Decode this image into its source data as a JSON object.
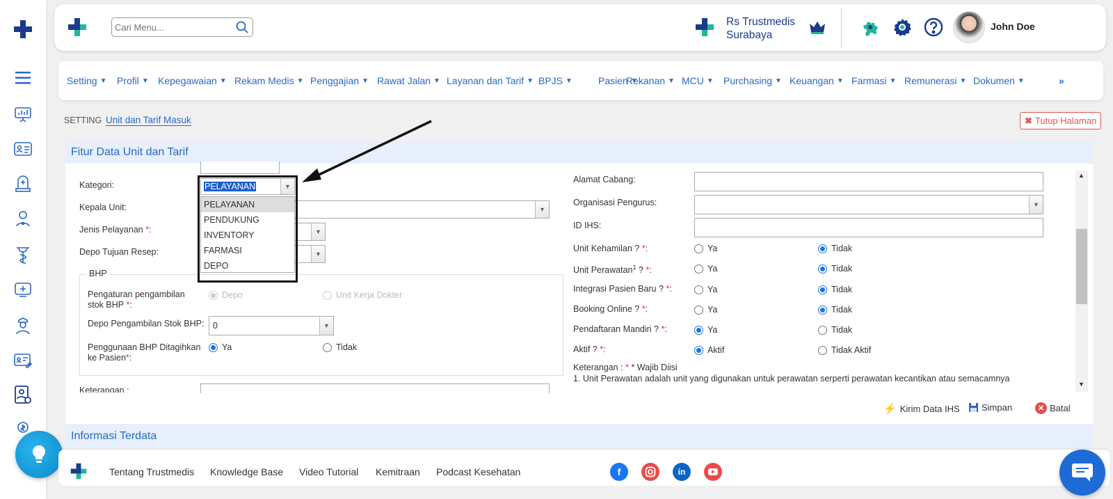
{
  "header": {
    "search_placeholder": "Cari Menu...",
    "hospital_line1": "Rs Trustmedis",
    "hospital_line2": "Surabaya",
    "user_name": "John Doe"
  },
  "menu": [
    {
      "label": "Setting"
    },
    {
      "label": "Profil"
    },
    {
      "label": "Kepegawaian"
    },
    {
      "label": "Rekam Medis"
    },
    {
      "label": "Penggajian"
    },
    {
      "label": "Rawat Jalan"
    },
    {
      "label": "Layanan dan Tarif"
    },
    {
      "label": "BPJS"
    },
    {
      "label": "Pasien"
    },
    {
      "label": "Rekanan"
    },
    {
      "label": "MCU"
    },
    {
      "label": "Purchasing"
    },
    {
      "label": "Keuangan"
    },
    {
      "label": "Farmasi"
    },
    {
      "label": "Remunerasi"
    },
    {
      "label": "Dokumen"
    }
  ],
  "menu_more": "»",
  "breadcrumb": {
    "root": "SETTING",
    "current": "Unit dan Tarif Masuk"
  },
  "close_page": "Tutup Halaman",
  "section1_title": "Fitur Data Unit dan Tarif",
  "section2_title": "Informasi Terdata",
  "form_left": {
    "kategori_label": "Kategori:",
    "kategori_value": "PELAYANAN",
    "kategori_options": [
      "PELAYANAN",
      "PENDUKUNG",
      "INVENTORY",
      "FARMASI",
      "DEPO"
    ],
    "kepala_unit_label": "Kepala Unit:",
    "jenis_pelayanan_label": "Jenis Pelayanan",
    "depo_tujuan_label": "Depo Tujuan Resep:",
    "bhp_legend": "BHP",
    "pengaturan_label_1": "Pengaturan pengambilan",
    "pengaturan_label_2": "stok BHP",
    "opt_depo": "Depo",
    "opt_unit_kerja": "Unit Kerja Dokter",
    "depo_stok_label": "Depo Pengambilan Stok BHP:",
    "depo_stok_value": "0",
    "penggunaan_label_1": "Penggunaan BHP Ditagihkan",
    "penggunaan_label_2": "ke Pasien",
    "opt_ya": "Ya",
    "opt_tidak": "Tidak",
    "keterangan_label": "Keterangan :"
  },
  "form_right": {
    "alamat_label": "Alamat Cabang:",
    "organisasi_label": "Organisasi Pengurus:",
    "id_ihs_label": "ID IHS:",
    "kehamilan_label": "Unit Kehamilan ?",
    "perawatan_label": "Unit Perawatan",
    "perawatan_sup": "1",
    "perawatan_tail": "?",
    "integrasi_label": "Integrasi Pasien Baru ?",
    "booking_label": "Booking Online ?",
    "pendaftaran_label": "Pendaftaran Mandiri ?",
    "aktif_label": "Aktif ?",
    "ya": "Ya",
    "tidak": "Tidak",
    "aktif": "Aktif",
    "tidak_aktif": "Tidak Aktif",
    "note_title": "Keterangan :",
    "note_req": "* Wajib Diisi",
    "note_1": "1. Unit Perawatan adalah unit yang digunakan untuk perawatan serperti perawatan kecantikan atau semacamnya"
  },
  "req_mark": "*",
  "actions": {
    "kirim": "Kirim Data IHS",
    "simpan": "Simpan",
    "batal": "Batal"
  },
  "footer": {
    "links": [
      "Tentang Trustmedis",
      "Knowledge Base",
      "Video Tutorial",
      "Kemitraan",
      "Podcast Kesehatan"
    ]
  },
  "colors": {
    "brand_blue": "#2a68c4",
    "brand_green": "#1fb89a",
    "facebook": "#1877f2",
    "instagram": "#e1306c",
    "linkedin": "#0a66c2",
    "youtube": "#e94b4b"
  }
}
